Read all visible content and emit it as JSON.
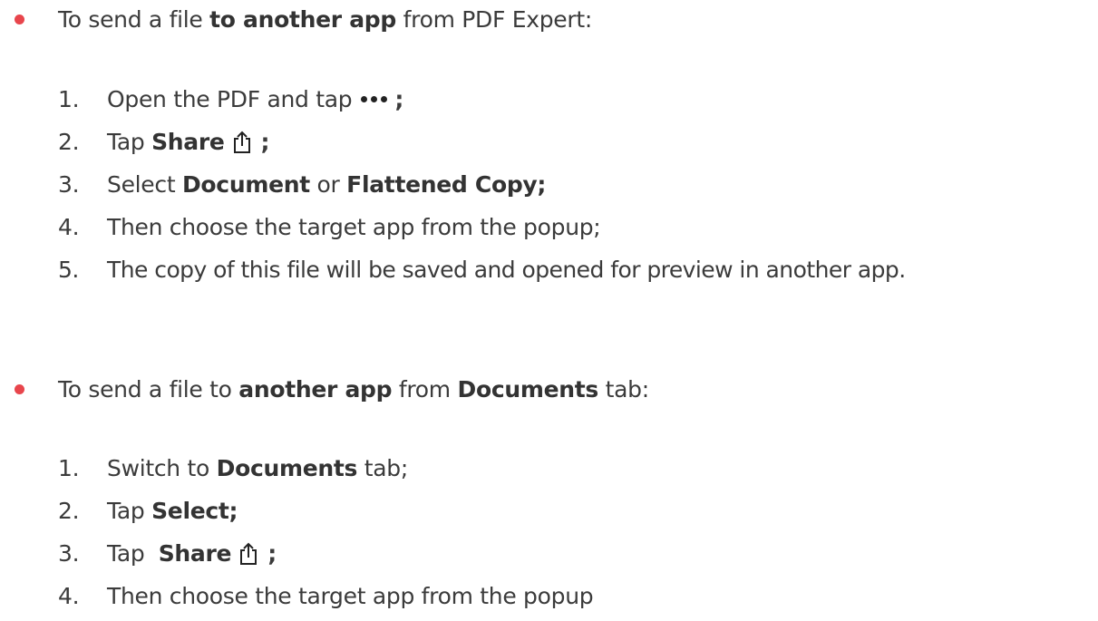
{
  "sections": [
    {
      "bullet": {
        "pre": "To send a file ",
        "bold1": "to another app",
        "post": " from PDF Expert:"
      },
      "steps": [
        {
          "num": "1.",
          "pre": "Open the PDF and tap",
          "icon": "more-dots-icon",
          "post": ";"
        },
        {
          "num": "2.",
          "pre": "Tap ",
          "bold": "Share",
          "icon": "share-icon",
          "post": ";"
        },
        {
          "num": "3.",
          "pre": "Select ",
          "bold": "Document",
          "mid": " or ",
          "bold2": "Flattened Copy;"
        },
        {
          "num": "4.",
          "text": "Then choose the target app from the popup;"
        },
        {
          "num": "5.",
          "text": "The copy of this file will be saved and opened for preview in another app."
        }
      ]
    },
    {
      "bullet": {
        "pre": "To send a file to ",
        "bold1": "another app",
        "mid": " from ",
        "bold2": "Documents",
        "post": " tab:"
      },
      "steps": [
        {
          "num": "1.",
          "pre": "Switch to ",
          "bold": "Documents",
          "post": " tab;"
        },
        {
          "num": "2.",
          "pre": "Tap ",
          "bold": "Select;"
        },
        {
          "num": "3.",
          "pre": "Tap  ",
          "bold": "Share",
          "icon": "share-icon",
          "post": ";"
        },
        {
          "num": "4.",
          "text": "Then choose the target app from the popup"
        }
      ]
    }
  ],
  "colors": {
    "bullet": "#e8454c",
    "text": "#3b3b3b"
  }
}
